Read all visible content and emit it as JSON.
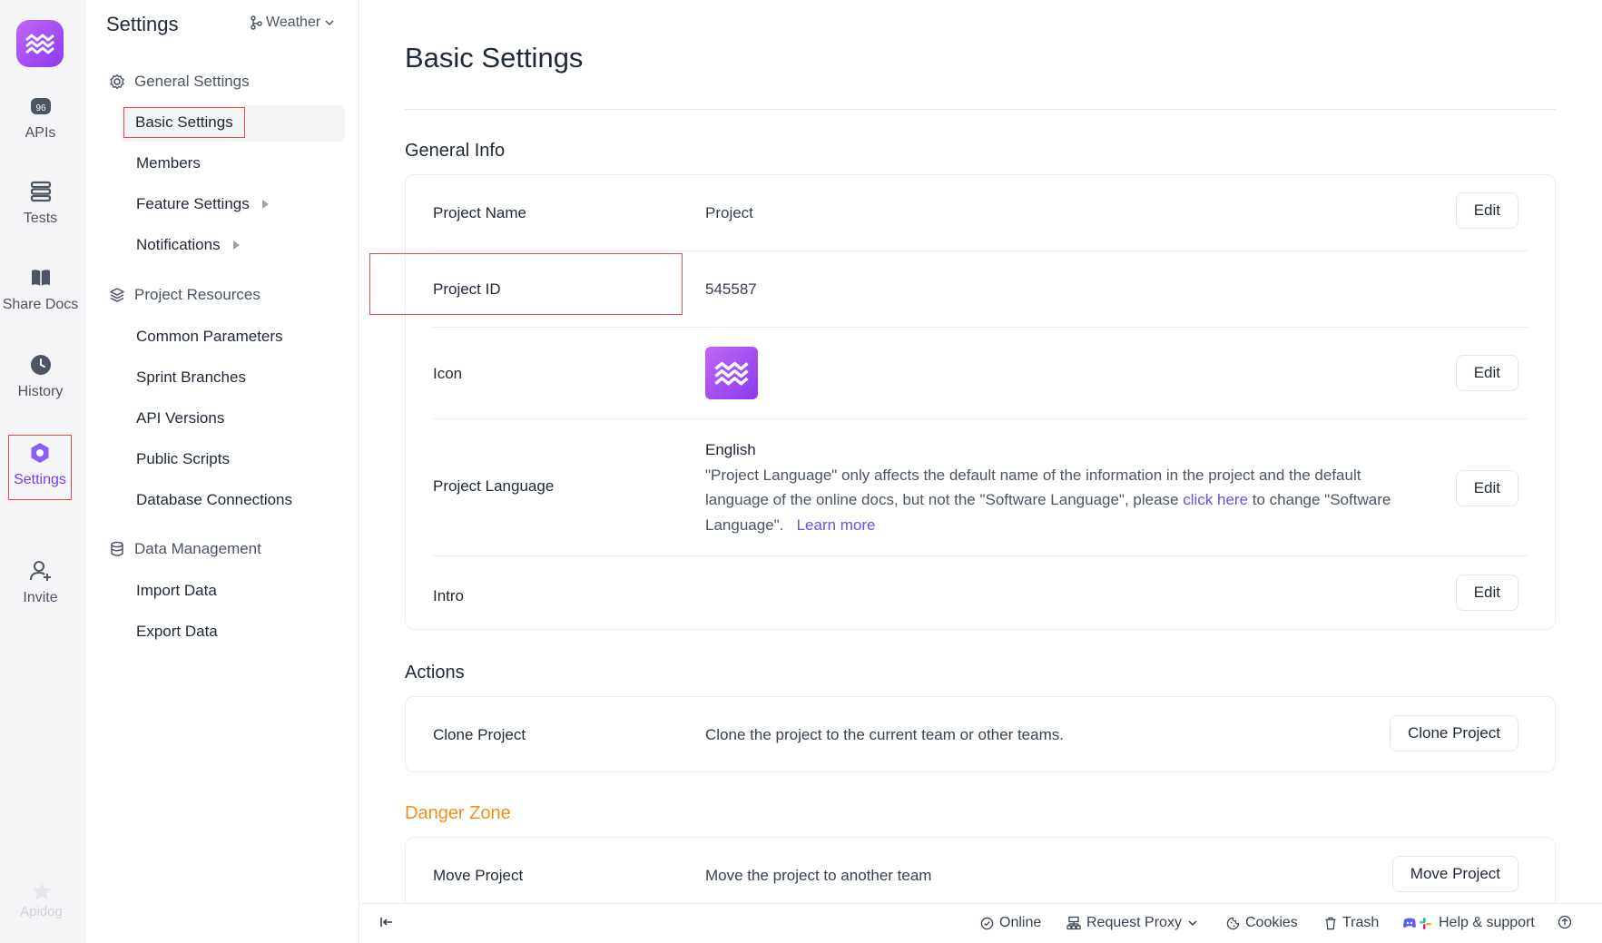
{
  "rail": {
    "brand_colors": [
      "#c065f5",
      "#8b3cf0"
    ],
    "items": [
      {
        "label": "APIs",
        "icon": "api-icon"
      },
      {
        "label": "Tests",
        "icon": "tests-icon"
      },
      {
        "label": "Share Docs",
        "icon": "book-icon"
      },
      {
        "label": "History",
        "icon": "clock-icon"
      },
      {
        "label": "Settings",
        "icon": "settings-icon",
        "active": true
      },
      {
        "label": "Invite",
        "icon": "user-plus-icon"
      }
    ],
    "brand_text": "Apidog"
  },
  "nav": {
    "title": "Settings",
    "branch": "Weather",
    "sections": [
      {
        "label": "General Settings",
        "icon": "gear-icon",
        "items": [
          {
            "label": "Basic Settings",
            "active": true
          },
          {
            "label": "Members"
          },
          {
            "label": "Feature Settings",
            "submenu": true
          },
          {
            "label": "Notifications",
            "submenu": true
          }
        ]
      },
      {
        "label": "Project Resources",
        "icon": "layers-icon",
        "items": [
          {
            "label": "Common Parameters"
          },
          {
            "label": "Sprint Branches"
          },
          {
            "label": "API Versions"
          },
          {
            "label": "Public Scripts"
          },
          {
            "label": "Database Connections"
          }
        ]
      },
      {
        "label": "Data Management",
        "icon": "database-icon",
        "items": [
          {
            "label": "Import Data"
          },
          {
            "label": "Export Data"
          }
        ]
      }
    ]
  },
  "main": {
    "title": "Basic Settings",
    "general_info": {
      "heading": "General Info",
      "project_name_label": "Project Name",
      "project_name_value": "Project",
      "project_id_label": "Project ID",
      "project_id_value": "545587",
      "icon_label": "Icon",
      "language_label": "Project Language",
      "language_value": "English",
      "language_note_1": "\"Project Language\" only affects the default name of the information in the project and the default language of the online docs, but not the \"Software Language\", please ",
      "language_link": "click here",
      "language_note_2": " to change \"Software Language\".",
      "learn_more": "Learn more",
      "intro_label": "Intro",
      "edit_label": "Edit"
    },
    "actions": {
      "heading": "Actions",
      "clone_label": "Clone Project",
      "clone_desc": "Clone the project to the current team or other teams.",
      "clone_button": "Clone Project"
    },
    "danger": {
      "heading": "Danger Zone",
      "move_label": "Move Project",
      "move_desc": "Move the project to another team",
      "move_button": "Move Project"
    }
  },
  "footer": {
    "online": "Online",
    "request_proxy": "Request Proxy",
    "cookies": "Cookies",
    "trash": "Trash",
    "help": "Help & support"
  },
  "colors": {
    "accent": "#7c3aed",
    "danger": "#f2901c",
    "link": "#6d4fe6",
    "highlight_box": "#e24b4b"
  }
}
